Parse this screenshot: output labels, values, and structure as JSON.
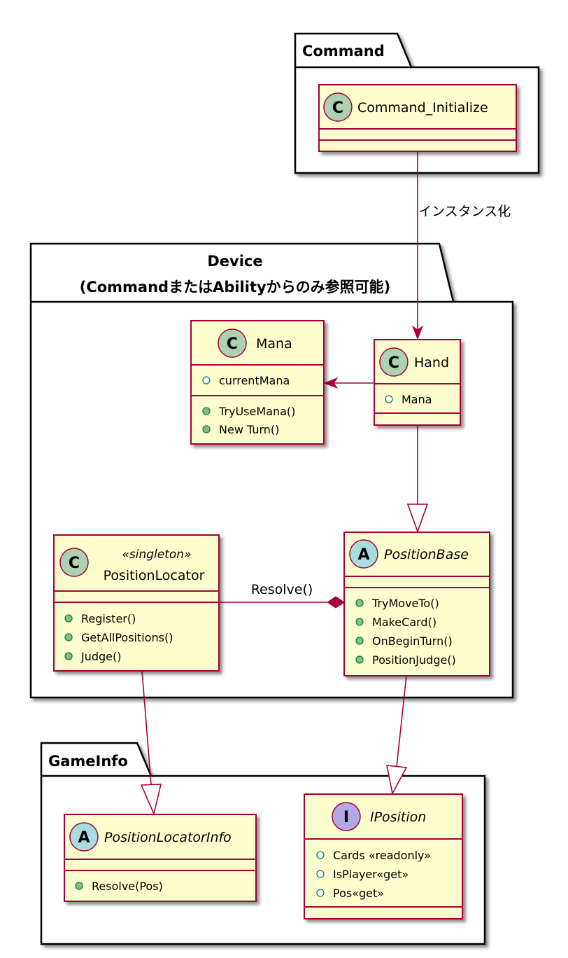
{
  "colors": {
    "class_fill": "#FEFECE",
    "class_border": "#A80036",
    "edge": "#A80036",
    "spot_class": "#ADD1B2",
    "spot_abstract": "#A9DCDF",
    "spot_interface": "#B4A7E5",
    "method_dot": "#84BE84",
    "field_dot": "#FFFFFF"
  },
  "packages": {
    "command": {
      "name": "Command"
    },
    "device": {
      "name_line1": "Device",
      "name_line2": "(CommandまたはAbilityからのみ参照可能)"
    },
    "gameinfo": {
      "name": "GameInfo"
    }
  },
  "classes": {
    "command_initialize": {
      "spot": "C",
      "name": "Command_Initialize",
      "fields": [],
      "methods": []
    },
    "mana": {
      "spot": "C",
      "name": "Mana",
      "fields": [
        "currentMana"
      ],
      "methods": [
        "TryUseMana()",
        "New Turn()"
      ]
    },
    "hand": {
      "spot": "C",
      "name": "Hand",
      "fields": [
        "Mana"
      ],
      "methods": []
    },
    "position_locator": {
      "spot": "C",
      "stereotype": "«singleton»",
      "name": "PositionLocator",
      "fields": [],
      "methods": [
        "Register()",
        "GetAllPositions()",
        "Judge()"
      ]
    },
    "position_base": {
      "spot": "A",
      "name": "PositionBase",
      "fields": [],
      "methods": [
        "TryMoveTo()",
        "MakeCard()",
        "OnBeginTurn()",
        "PositionJudge()"
      ]
    },
    "position_locator_info": {
      "spot": "A",
      "name": "PositionLocatorInfo",
      "fields": [],
      "methods": [
        "Resolve(Pos)"
      ]
    },
    "iposition": {
      "spot": "I",
      "name": "IPosition",
      "fields": [
        "Cards «readonly»",
        "IsPlayer«get»",
        "Pos«get»"
      ],
      "methods": []
    }
  },
  "edges": {
    "instantiate_label": "インスタンス化",
    "resolve_label": "Resolve()"
  }
}
